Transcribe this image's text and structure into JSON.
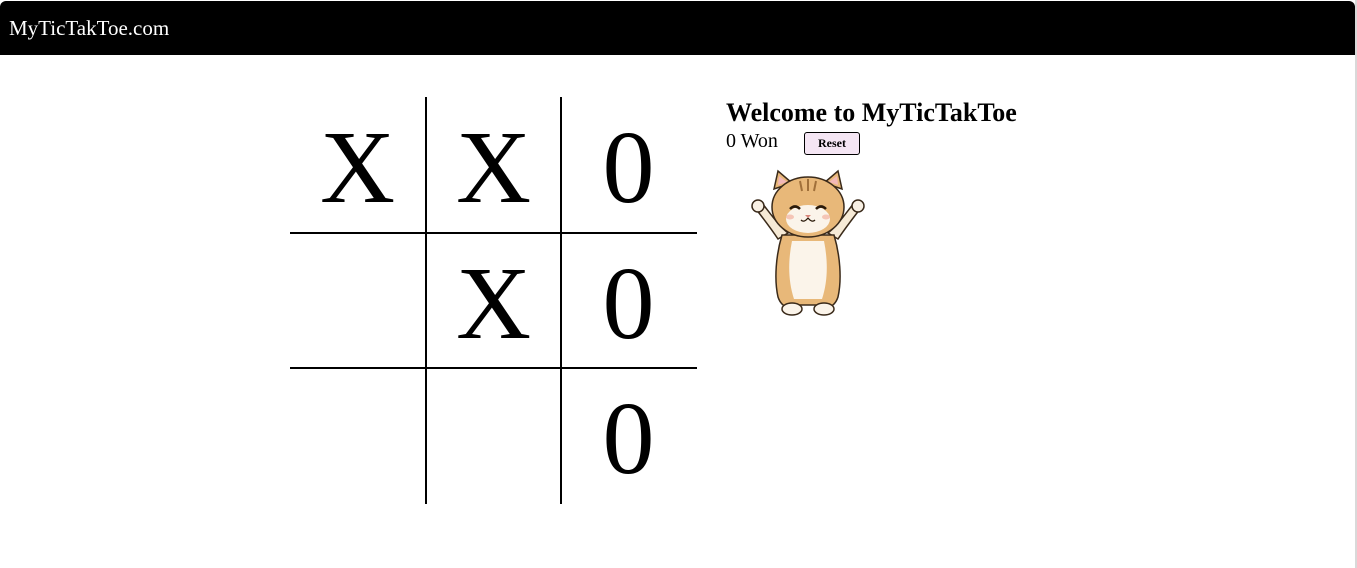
{
  "site": {
    "title": "MyTicTakToe.com"
  },
  "board": {
    "cells": [
      [
        "X",
        "X",
        "0"
      ],
      [
        "",
        "X",
        "0"
      ],
      [
        "",
        "",
        "0"
      ]
    ]
  },
  "info": {
    "heading": "Welcome to MyTicTakToe",
    "score": "0 Won",
    "reset_label": "Reset",
    "image_icon": "cheering-cat-icon"
  },
  "colors": {
    "topbar": "#000000",
    "title_text": "#ffffff",
    "reset_bg": "#f5e6f4",
    "cat_fur": "#e8b879"
  }
}
